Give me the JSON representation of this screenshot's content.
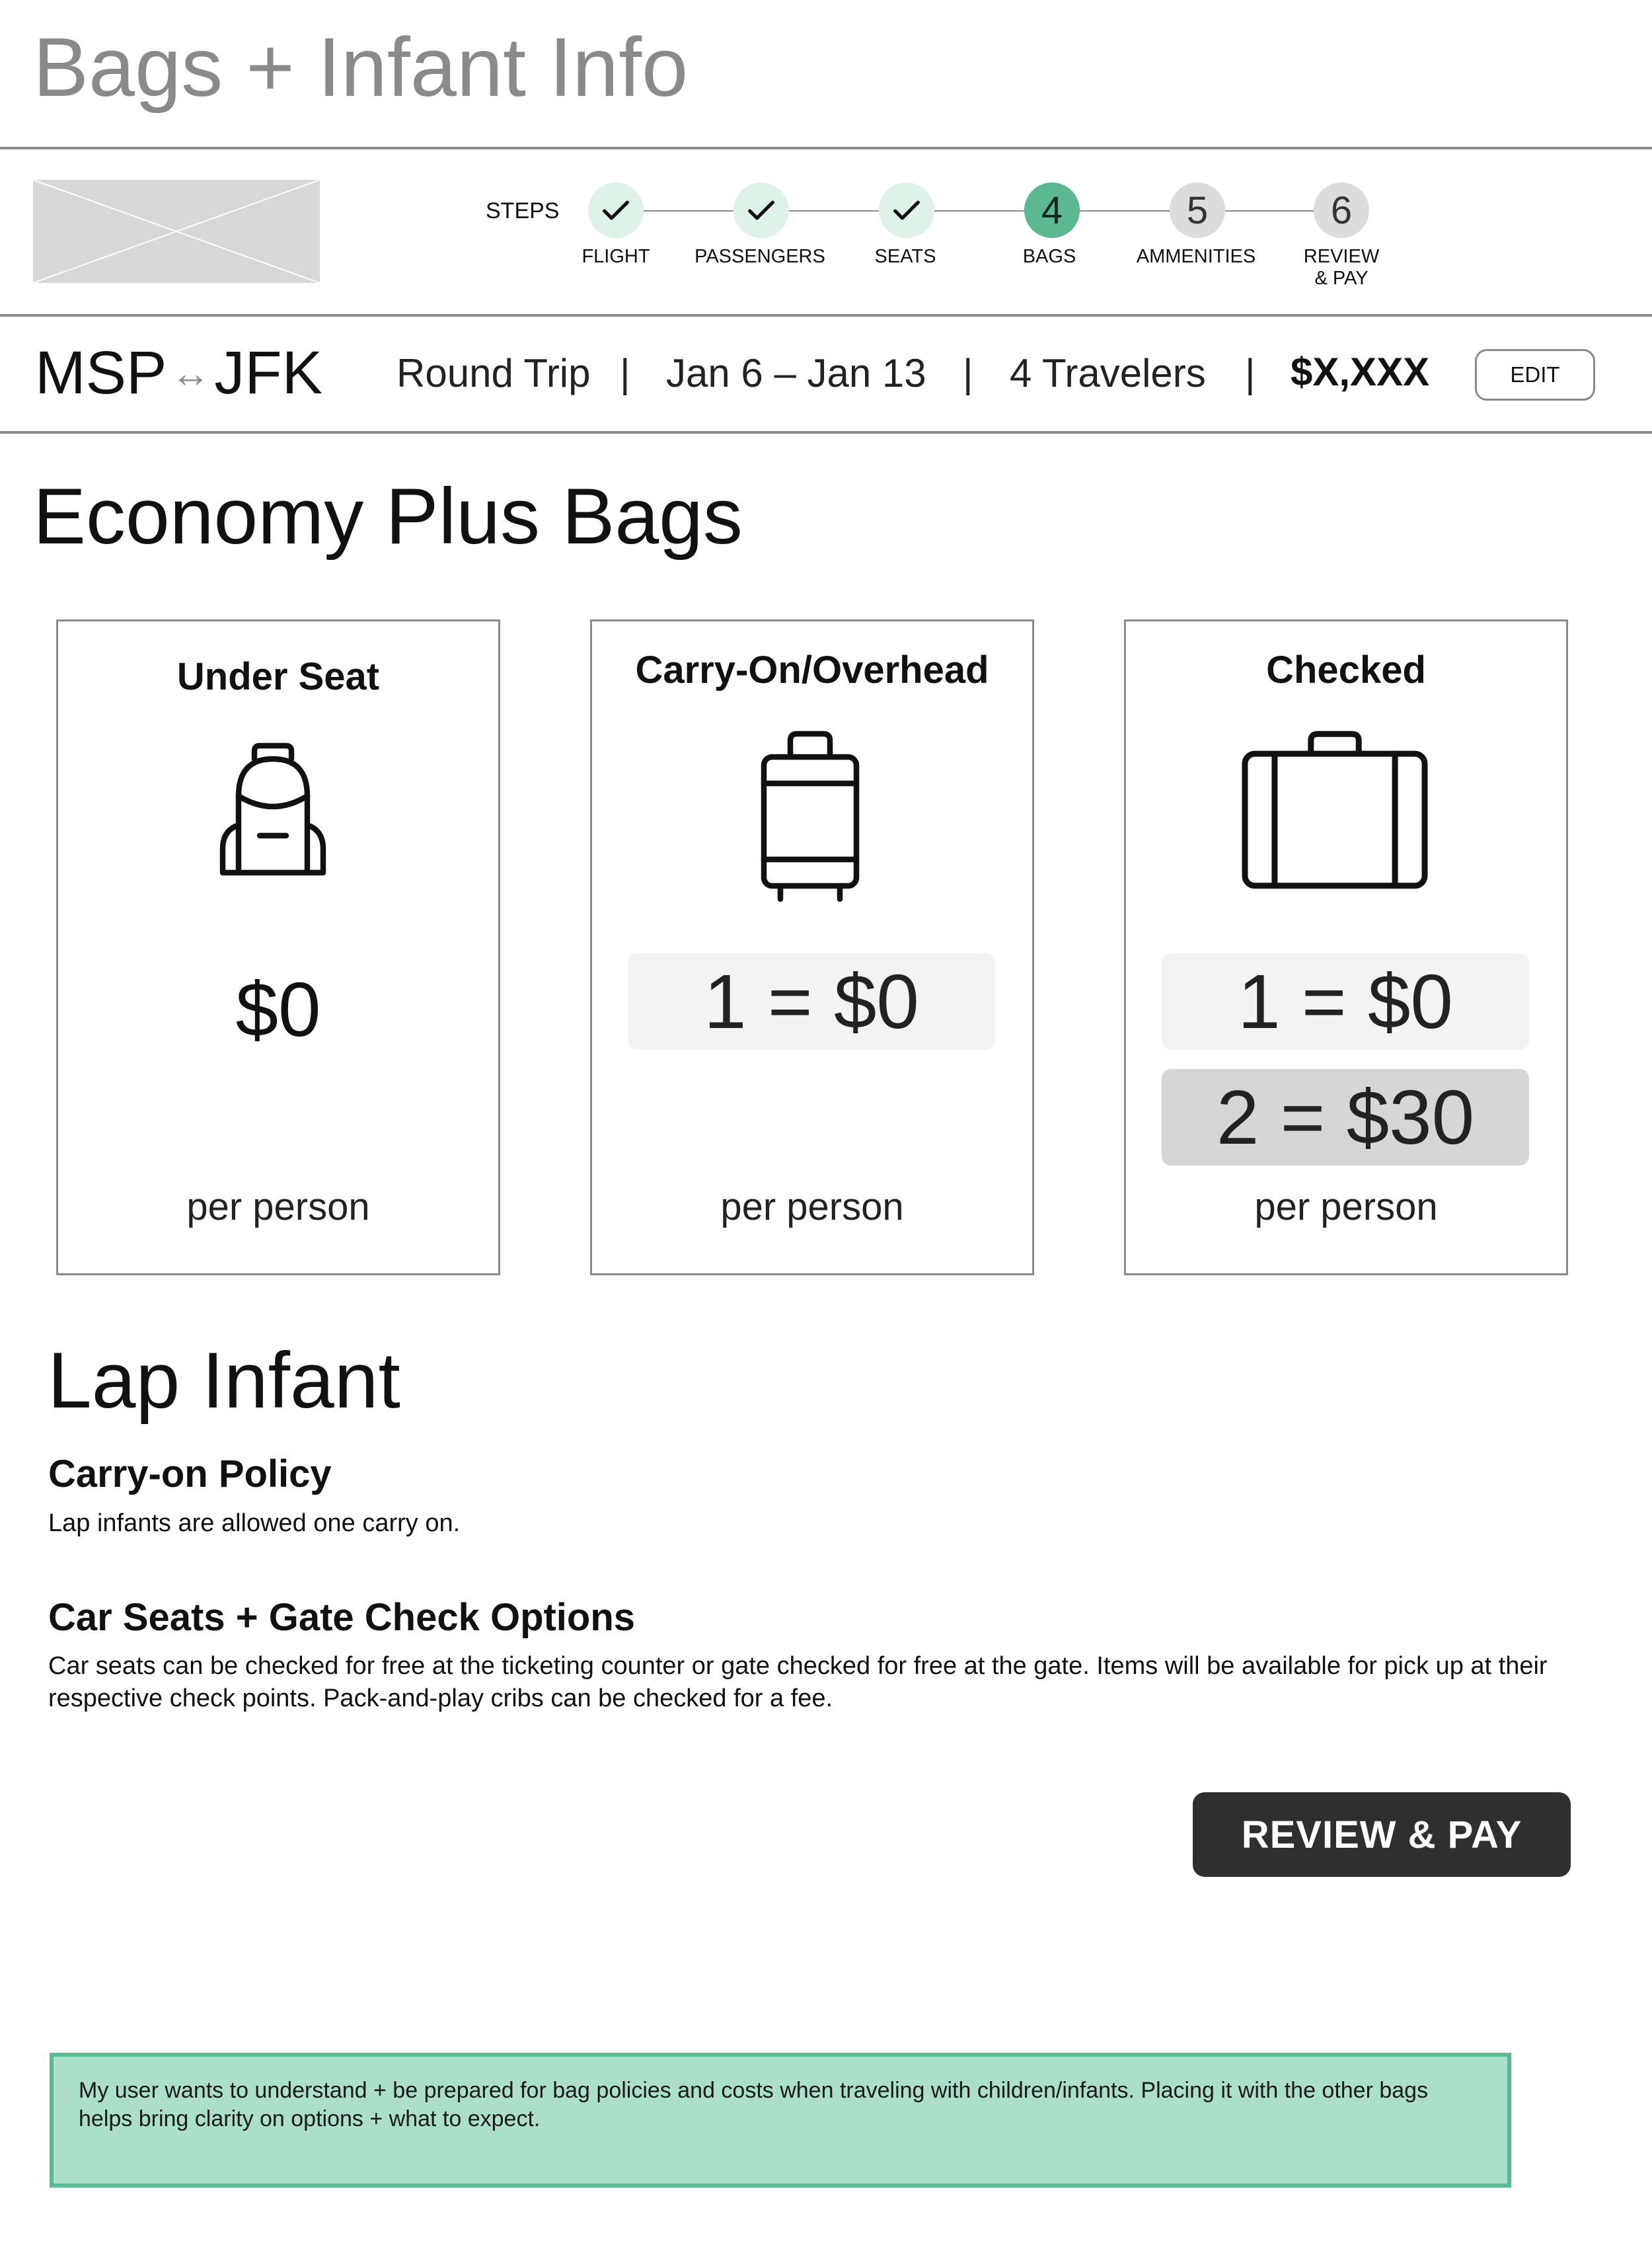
{
  "page": {
    "title": "Bags + Infant Info"
  },
  "steps": {
    "label": "STEPS",
    "items": [
      {
        "label": "FLIGHT",
        "state": "done",
        "number": "1"
      },
      {
        "label": "PASSENGERS",
        "state": "done",
        "number": "2"
      },
      {
        "label": "SEATS",
        "state": "done",
        "number": "3"
      },
      {
        "label": "BAGS",
        "state": "active",
        "number": "4"
      },
      {
        "label": "AMMENITIES",
        "state": "pending",
        "number": "5"
      },
      {
        "label": "REVIEW\n& PAY",
        "state": "pending",
        "number": "6"
      }
    ]
  },
  "trip": {
    "origin": "MSP",
    "arrow": "↔",
    "destination": "JFK",
    "type": "Round Trip",
    "dates": "Jan 6 – Jan 13",
    "travelers": "4 Travelers",
    "separator": "|",
    "price": "$X,XXX",
    "edit_label": "EDIT"
  },
  "bags": {
    "heading": "Economy Plus Bags",
    "cards": [
      {
        "title": "Under Seat",
        "icon": "backpack-icon",
        "price": "$0",
        "per": "per person"
      },
      {
        "title": "Carry-On/Overhead",
        "icon": "rolling-suitcase-icon",
        "options": [
          "1 = $0"
        ],
        "per": "per person"
      },
      {
        "title": "Checked",
        "icon": "suitcase-icon",
        "options": [
          "1 = $0",
          "2 = $30"
        ],
        "per": "per person"
      }
    ]
  },
  "infant": {
    "heading": "Lap Infant",
    "policy_title": "Carry-on Policy",
    "policy_text": "Lap infants are allowed one carry on.",
    "carseat_title": "Car Seats + Gate Check Options",
    "carseat_text": "Car seats can be checked for free at the ticketing counter or gate checked for free at the gate. Items will be available for pick up at their respective check points. Pack-and-play cribs can be checked for a fee."
  },
  "cta": {
    "label": "REVIEW & PAY"
  },
  "note": {
    "text": "My user wants to understand + be prepared for bag policies and costs when traveling with children/infants. Placing it with the other bags helps bring clarity on options + what to expect."
  },
  "colors": {
    "accent": "#5cb891",
    "step_done": "#dff2e8",
    "note_bg": "#abdfc8",
    "cta_bg": "#2f2f2f",
    "rule": "#8a8a8a"
  }
}
